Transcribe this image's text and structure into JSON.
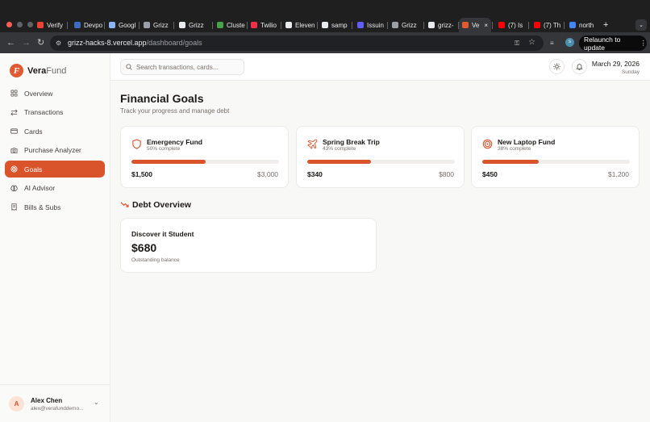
{
  "browser": {
    "tabs": [
      {
        "label": "Verify",
        "icon": "gmail-icon",
        "color": "#ea4335"
      },
      {
        "label": "Devpo",
        "icon": "devpost-icon",
        "color": "#3f6bbd"
      },
      {
        "label": "Googl",
        "icon": "google-ai-icon",
        "color": "#8ab4f8"
      },
      {
        "label": "Grizz",
        "icon": "grizz-icon",
        "color": "#9aa0a6"
      },
      {
        "label": "Grizz",
        "icon": "github-icon",
        "color": "#e8eaed"
      },
      {
        "label": "Cluste",
        "icon": "mongodb-icon",
        "color": "#47a248"
      },
      {
        "label": "Twilio",
        "icon": "twilio-icon",
        "color": "#f22f46"
      },
      {
        "label": "Eleven",
        "icon": "elevenlabs-icon",
        "color": "#e8eaed"
      },
      {
        "label": "samp",
        "icon": "github-icon",
        "color": "#e8eaed"
      },
      {
        "label": "Issuin",
        "icon": "issuing-icon",
        "color": "#635bff"
      },
      {
        "label": "Grizz",
        "icon": "grizz-icon",
        "color": "#9aa0a6"
      },
      {
        "label": "grizz-",
        "icon": "vercel-icon",
        "color": "#e8eaed"
      },
      {
        "label": "Ve",
        "icon": "verafund-icon",
        "color": "#e05a32"
      },
      {
        "label": "(7) Is",
        "icon": "youtube-icon",
        "color": "#ff0000"
      },
      {
        "label": "(7) Th",
        "icon": "youtube-icon",
        "color": "#ff0000"
      },
      {
        "label": "north",
        "icon": "google-icon",
        "color": "#4285f4"
      }
    ],
    "url_host": "grizz-hacks-8.vercel.app",
    "url_path": "/dashboard/goals",
    "relaunch_label": "Relaunch to update",
    "profile_initial": "s"
  },
  "sidebar": {
    "brand_a": "Vera",
    "brand_b": "Fund",
    "logo_letter": "F",
    "items": [
      {
        "label": "Overview",
        "icon": "grid-icon"
      },
      {
        "label": "Transactions",
        "icon": "arrows-icon"
      },
      {
        "label": "Cards",
        "icon": "card-icon"
      },
      {
        "label": "Purchase Analyzer",
        "icon": "camera-icon"
      },
      {
        "label": "Goals",
        "icon": "target-icon",
        "active": true
      },
      {
        "label": "AI Advisor",
        "icon": "brain-icon"
      },
      {
        "label": "Bills & Subs",
        "icon": "receipt-icon"
      }
    ],
    "user": {
      "initial": "A",
      "name": "Alex Chen",
      "email": "alex@verafunddemo..."
    }
  },
  "topbar": {
    "search_placeholder": "Search transactions, cards...",
    "date": "March 29, 2026",
    "weekday": "Sunday"
  },
  "page": {
    "title": "Financial Goals",
    "subtitle": "Track your progress and manage debt"
  },
  "goals": [
    {
      "title": "Emergency Fund",
      "pct_text": "50% complete",
      "progress": 0.5,
      "current": "$1,500",
      "target": "$3,000",
      "icon": "shield-icon"
    },
    {
      "title": "Spring Break Trip",
      "pct_text": "43% complete",
      "progress": 0.43,
      "current": "$340",
      "target": "$800",
      "icon": "plane-icon"
    },
    {
      "title": "New Laptop Fund",
      "pct_text": "38% complete",
      "progress": 0.38,
      "current": "$450",
      "target": "$1,200",
      "icon": "target-icon"
    }
  ],
  "debt": {
    "heading": "Debt Overview",
    "card": {
      "name": "Discover it Student",
      "amount": "$680",
      "label": "Outstanding balance"
    }
  },
  "colors": {
    "accent": "#d9532b",
    "track": "#f0eeeb"
  }
}
